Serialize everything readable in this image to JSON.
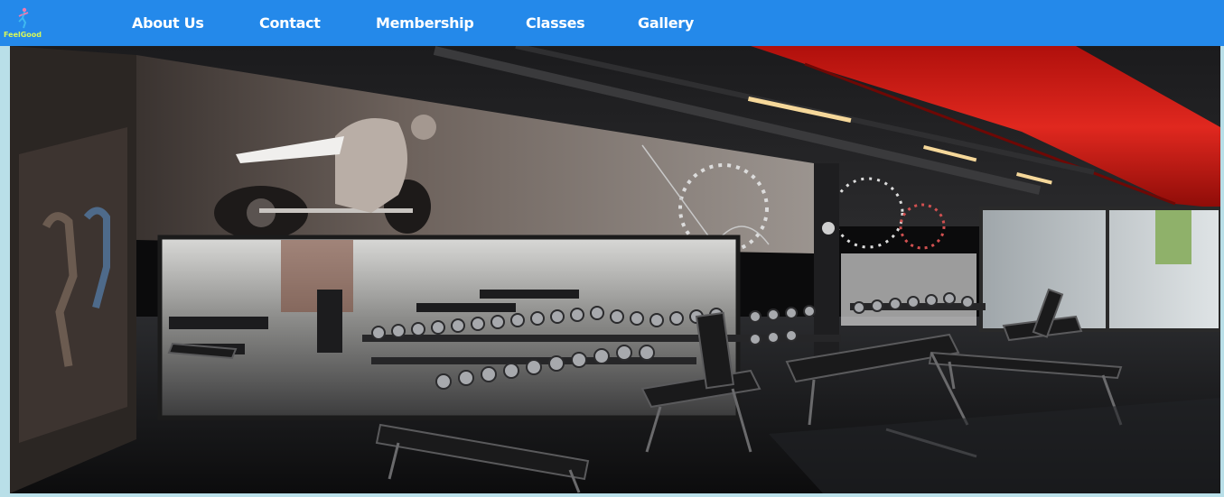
{
  "brand": {
    "name": "FeelGood",
    "logo_icon": "runner-figure-icon",
    "text_color": "#d7f75a"
  },
  "nav": {
    "items": [
      {
        "label": "About Us"
      },
      {
        "label": "Contact"
      },
      {
        "label": "Membership"
      },
      {
        "label": "Classes"
      },
      {
        "label": "Gallery"
      }
    ]
  },
  "colors": {
    "navbar": "#2489ea",
    "page_background": "#b9dfe8",
    "nav_text": "#ffffff",
    "duct_red": "#d8221b"
  },
  "hero": {
    "image_description_icon": "gym-interior-photo"
  }
}
